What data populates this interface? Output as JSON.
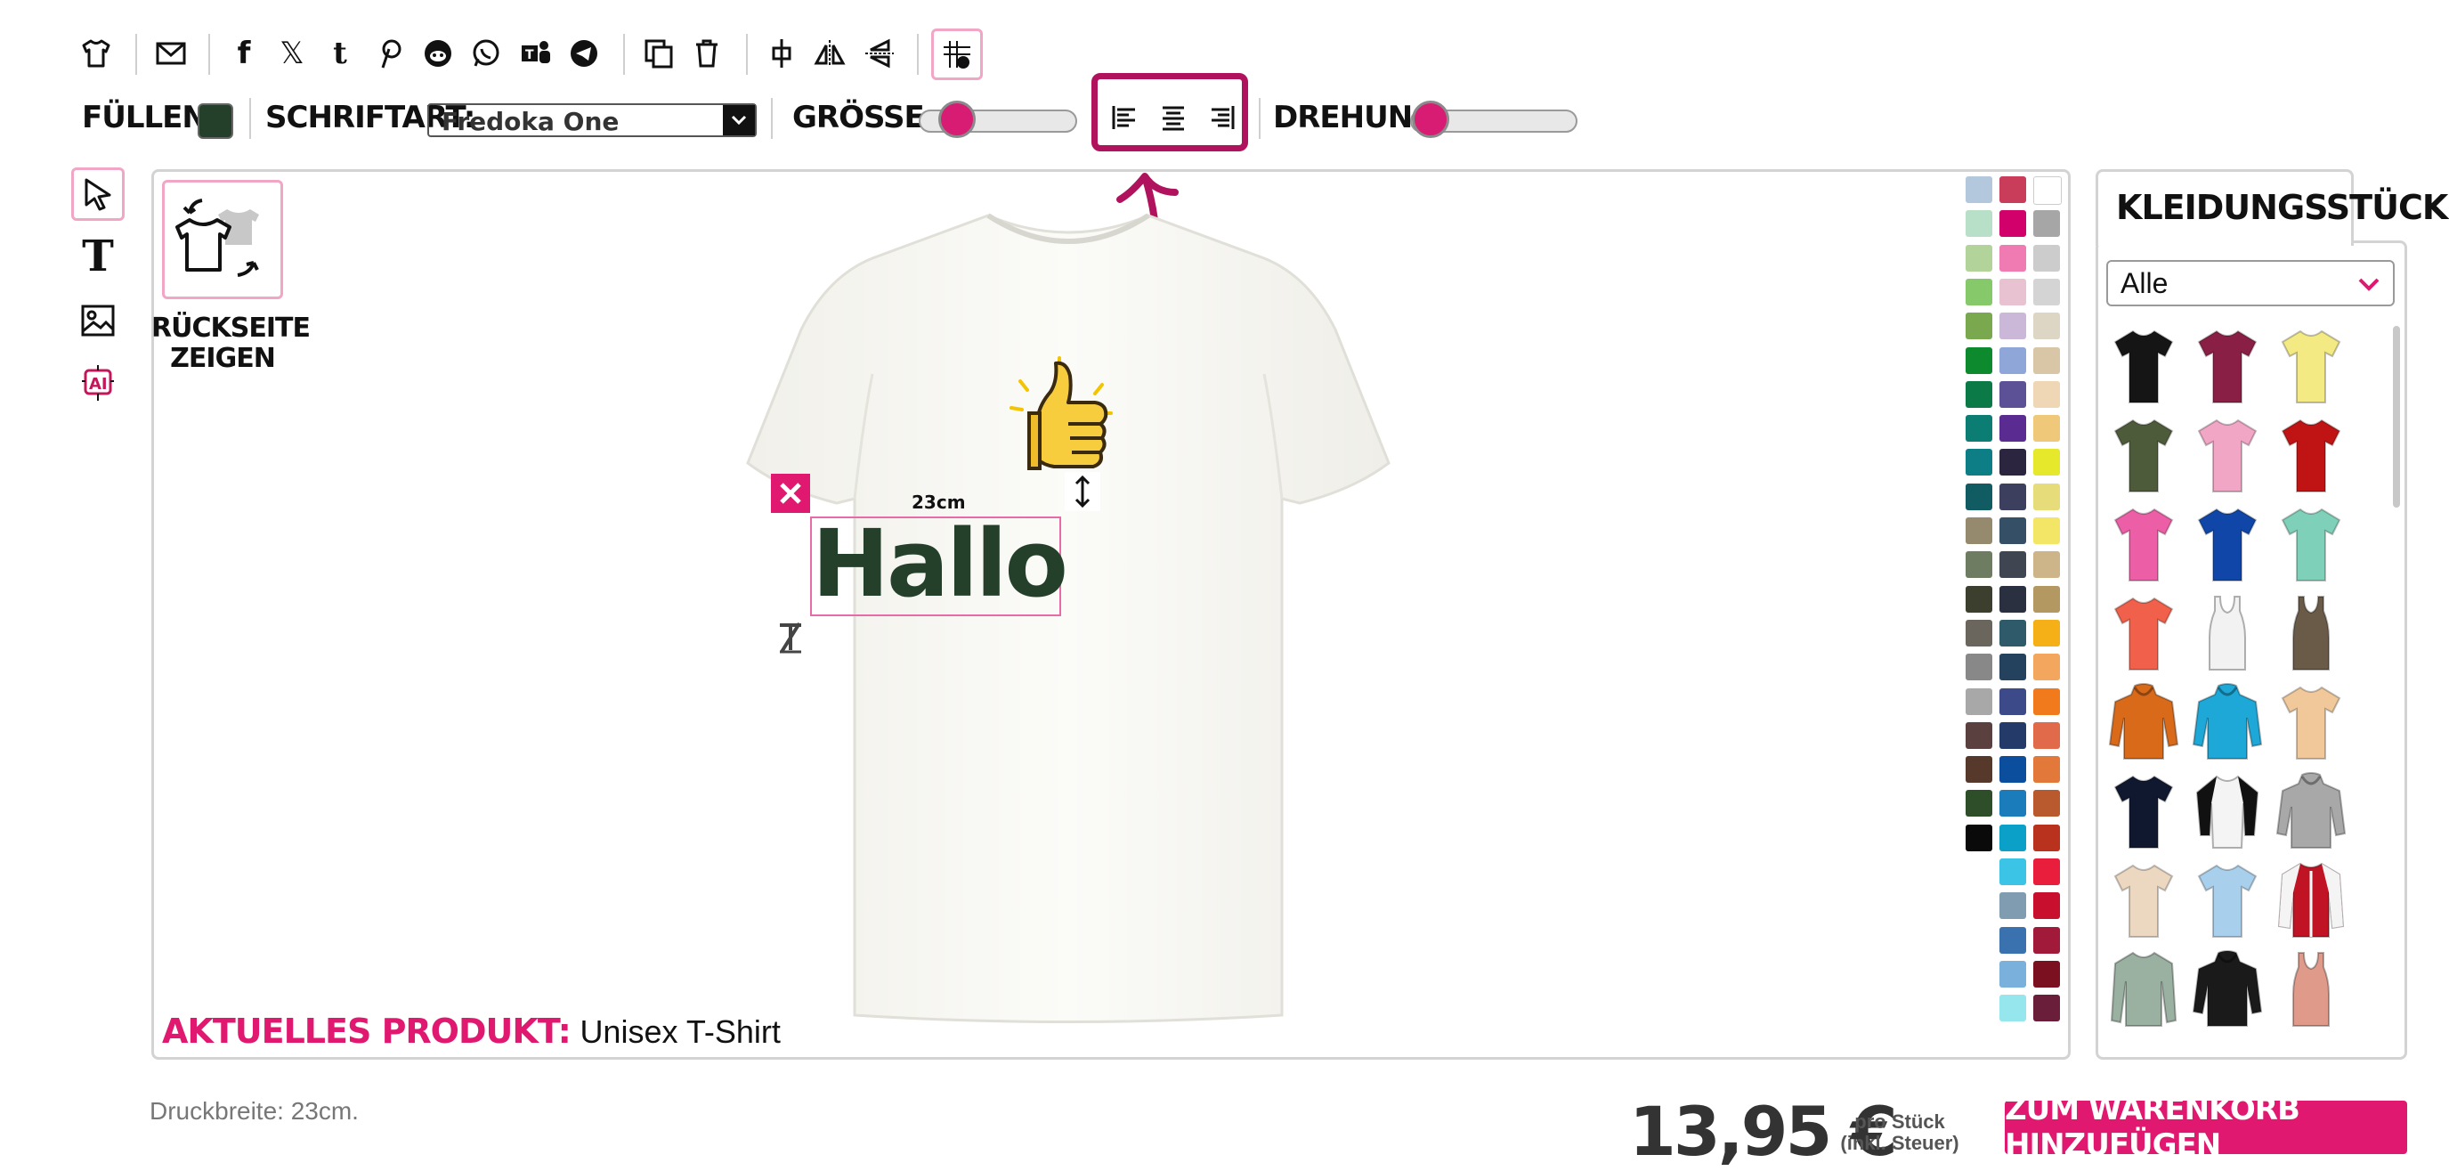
{
  "toolbar": {
    "fill_label": "FÜLLEN:",
    "fill_color": "#24402a",
    "font_label": "SCHRIFTART:",
    "font_value": "Fredoka One",
    "size_label": "GRÖSSE:",
    "size_value": 0.15,
    "rotation_label": "DREHUNG:",
    "rotation_value": 0.0,
    "icons": [
      "tshirt-icon",
      "mail-icon",
      "facebook-icon",
      "x-icon",
      "tumblr-icon",
      "pinterest-icon",
      "reddit-icon",
      "whatsapp-icon",
      "teams-icon",
      "telegram-icon",
      "duplicate-icon",
      "trash-icon",
      "center-align-object-icon",
      "flip-horizontal-icon",
      "flip-vertical-icon",
      "grid-snap-icon"
    ],
    "align_icons": [
      "align-left-icon",
      "align-center-icon",
      "align-right-icon"
    ]
  },
  "side_tools": [
    "select-pointer-icon",
    "text-tool-icon",
    "image-tool-icon",
    "ai-tool-icon"
  ],
  "canvas": {
    "back_side_label_line1": "RÜCKSEITE",
    "back_side_label_line2": "ZEIGEN",
    "text_object": "Hallo",
    "text_color": "#24402a",
    "size_indicator": "23cm",
    "current_product_label": "AKTUELLES PRODUKT:",
    "current_product_name": "Unisex T-Shirt"
  },
  "palette_colors": [
    [
      "#b3c8dd",
      "#c93d5a",
      "#ffffff"
    ],
    [
      "#b8e0c8",
      "#d1006a",
      "#a6a6a6"
    ],
    [
      "#b2d39a",
      "#f07ab2",
      "#cccccc"
    ],
    [
      "#85c96a",
      "#e9c2d2",
      "#d4d4d4"
    ],
    [
      "#7aa84e",
      "#cbb8d8",
      "#ddd6c5"
    ],
    [
      "#0e8a2e",
      "#8fa6d8",
      "#d9c6a6"
    ],
    [
      "#0b7a46",
      "#5c5096",
      "#efd6b4"
    ],
    [
      "#0b7d72",
      "#5a2c92",
      "#efc87a"
    ],
    [
      "#0e7e86",
      "#2c2540",
      "#e6e82c"
    ],
    [
      "#115b63",
      "#3d3f5e",
      "#e6dc7a"
    ],
    [
      "#958a6e",
      "#344f66",
      "#f3e565"
    ],
    [
      "#6e7d62",
      "#3f4652",
      "#cdb489"
    ],
    [
      "#3c3f2e",
      "#2a3040",
      "#b49862"
    ],
    [
      "#6b665d",
      "#2e5a6a",
      "#f4b016"
    ],
    [
      "#888888",
      "#24415e",
      "#f2a65e"
    ],
    [
      "#a8a8a8",
      "#3c4a8a",
      "#f07a1c"
    ],
    [
      "#5b4040",
      "#243a68",
      "#e06a4a"
    ],
    [
      "#56392a",
      "#0b4e9e",
      "#e2793a"
    ],
    [
      "#2e4e2a",
      "#1a7cba",
      "#b85a2e"
    ],
    [
      "#0a0a0a",
      "#0aa0c8",
      "#b8321e"
    ],
    [
      "",
      "#3cc4e6",
      "#e81e3c"
    ],
    [
      "",
      "#7f9cb0",
      "#c8102e"
    ],
    [
      "",
      "#3a72b0",
      "#a21a3a"
    ],
    [
      "",
      "#7ab0dc",
      "#7a1020"
    ],
    [
      "",
      "#96e6ee",
      "#6a1e3a"
    ]
  ],
  "panel": {
    "tab_label": "KLEIDUNGSSTÜCK",
    "filter_value": "Alle",
    "garments": [
      {
        "name": "tshirt-black",
        "color": "#151515",
        "shape": "tee"
      },
      {
        "name": "tshirt-burgundy",
        "color": "#8a1f45",
        "shape": "tee"
      },
      {
        "name": "tshirt-yellow",
        "color": "#f3ea84",
        "shape": "tee"
      },
      {
        "name": "tshirt-olive",
        "color": "#4e5b3a",
        "shape": "tee"
      },
      {
        "name": "tshirt-pink",
        "color": "#f2a6c6",
        "shape": "tee"
      },
      {
        "name": "tshirt-red",
        "color": "#c01414",
        "shape": "tee"
      },
      {
        "name": "tshirt-hotpink",
        "color": "#ec5ea6",
        "shape": "tee"
      },
      {
        "name": "tshirt-royal",
        "color": "#1046a8",
        "shape": "tee"
      },
      {
        "name": "tshirt-mint",
        "color": "#7fd0b8",
        "shape": "tee"
      },
      {
        "name": "tshirt-coral",
        "color": "#f0604a",
        "shape": "tee"
      },
      {
        "name": "tanktop-white",
        "color": "#f2f2f2",
        "shape": "tank"
      },
      {
        "name": "tanktop-brown",
        "color": "#6a5a48",
        "shape": "tank"
      },
      {
        "name": "hoodie-orange",
        "color": "#d86a1a",
        "shape": "hoodie"
      },
      {
        "name": "hoodie-cyan",
        "color": "#1ea8d8",
        "shape": "hoodie"
      },
      {
        "name": "tshirt-tiedye",
        "color": "#f0c89a",
        "shape": "tee"
      },
      {
        "name": "tshirt-navy",
        "color": "#101830",
        "shape": "tee"
      },
      {
        "name": "raglan-black-white",
        "color": "#f4f4f4",
        "shape": "raglan"
      },
      {
        "name": "hoodie-grey",
        "color": "#a8a8a8",
        "shape": "hoodie"
      },
      {
        "name": "tshirt-beige",
        "color": "#ecd8c0",
        "shape": "tee"
      },
      {
        "name": "tshirt-lightblue",
        "color": "#a8d0ec",
        "shape": "tee"
      },
      {
        "name": "jacket-red",
        "color": "#c01424",
        "shape": "jacket"
      },
      {
        "name": "longsleeve-sage",
        "color": "#9ab0a0",
        "shape": "longsleeve"
      },
      {
        "name": "hoodie-black-orange",
        "color": "#1a1a1a",
        "shape": "hoodie"
      },
      {
        "name": "tanktop-salmon",
        "color": "#e09a8a",
        "shape": "tank"
      }
    ]
  },
  "footer": {
    "print_width": "Druckbreite: 23cm.",
    "price": "13,95 €",
    "per_piece": "pro Stück",
    "incl_tax": "(inkl. Steuer)",
    "cta_label": "ZUM WARENKORB HINZUFÜGEN"
  },
  "accent_color": "#e0186f",
  "annotation_color": "#b0125e"
}
